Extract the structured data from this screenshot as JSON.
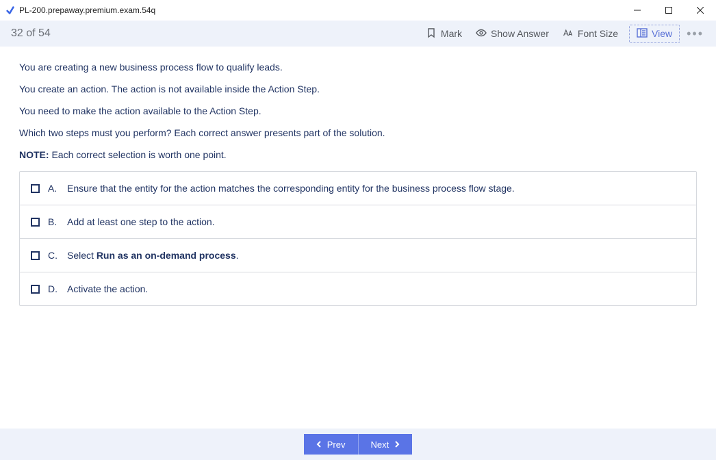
{
  "window": {
    "title": "PL-200.prepaway.premium.exam.54q"
  },
  "toolbar": {
    "counter": "32 of 54",
    "mark": "Mark",
    "show_answer": "Show Answer",
    "font_size": "Font Size",
    "view": "View",
    "more": "•••"
  },
  "question": {
    "paragraphs": [
      "You are creating a new business process flow to qualify leads.",
      "You create an action. The action is not available inside the Action Step.",
      "You need to make the action available to the Action Step.",
      "Which two steps must you perform? Each correct answer presents part of the solution."
    ],
    "note_label": "NOTE:",
    "note_text": " Each correct selection is worth one point."
  },
  "options": [
    {
      "letter": "A.",
      "pre": "Ensure that the entity for the action matches the corresponding entity for the business process flow stage.",
      "bold": "",
      "post": ""
    },
    {
      "letter": "B.",
      "pre": "Add at least one step to the action.",
      "bold": "",
      "post": ""
    },
    {
      "letter": "C.",
      "pre": "Select ",
      "bold": "Run as an on-demand process",
      "post": "."
    },
    {
      "letter": "D.",
      "pre": "Activate the action.",
      "bold": "",
      "post": ""
    }
  ],
  "footer": {
    "prev": "Prev",
    "next": "Next"
  }
}
